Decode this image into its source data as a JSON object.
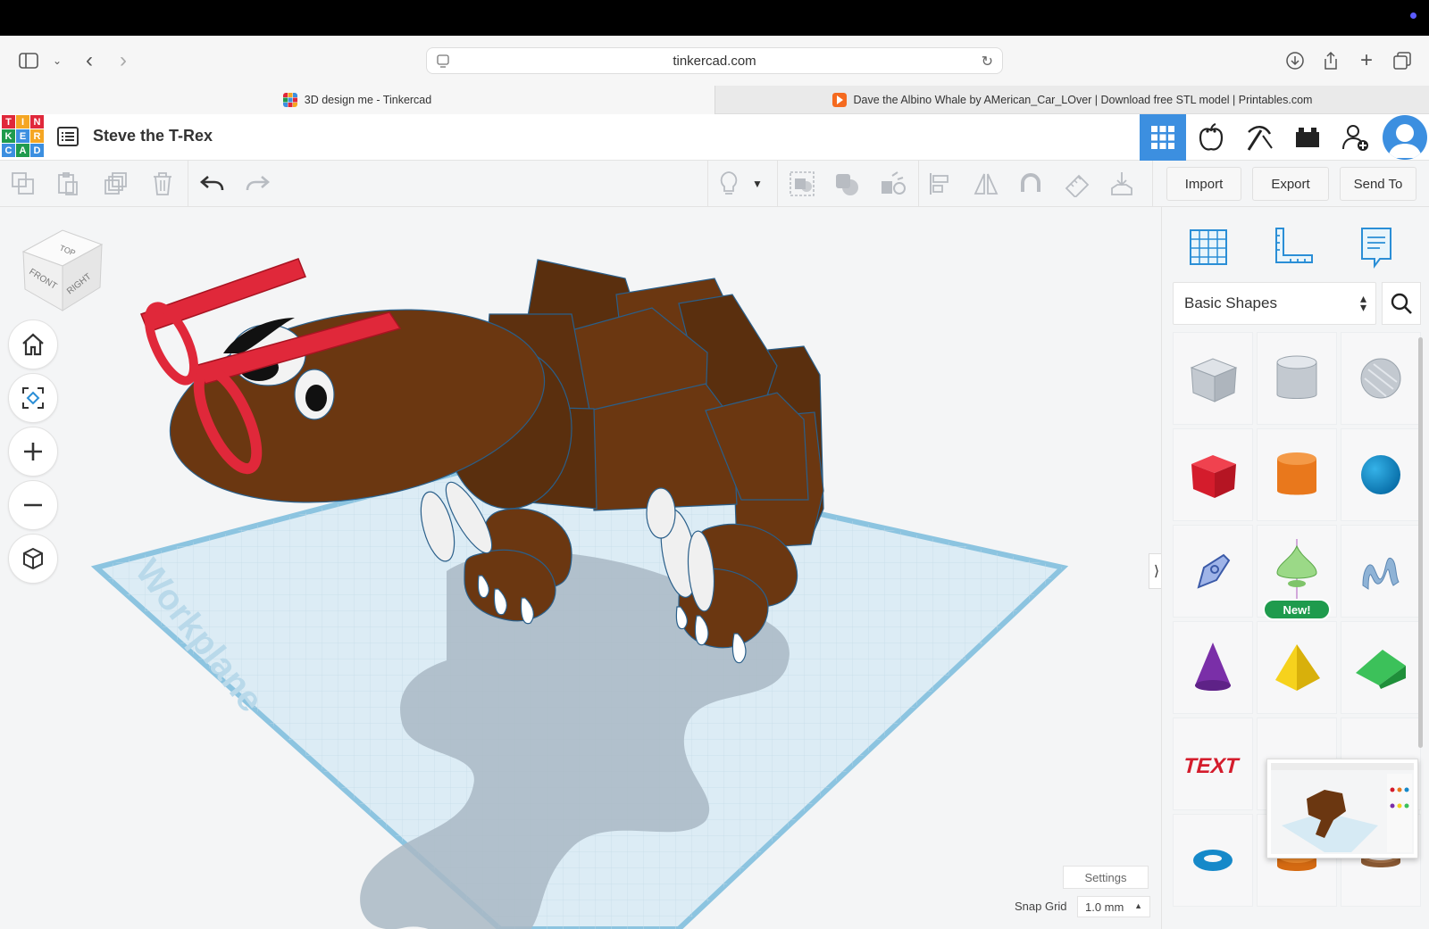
{
  "browser": {
    "url": "tinkercad.com",
    "tabs": [
      {
        "label": "3D design me - Tinkercad"
      },
      {
        "label": "Dave the Albino Whale by AMerican_Car_LOver | Download free STL model | Printables.com"
      }
    ]
  },
  "app": {
    "logo_letters": [
      "T",
      "I",
      "N",
      "K",
      "E",
      "R",
      "C",
      "A",
      "D"
    ],
    "design_title": "Steve the T-Rex"
  },
  "toolbar": {
    "import_label": "Import",
    "export_label": "Export",
    "send_to_label": "Send To"
  },
  "viewport": {
    "view_cube": {
      "top": "TOP",
      "front": "FRONT",
      "right": "RIGHT"
    },
    "workplane_label": "Workplane",
    "settings_label": "Settings",
    "snap_grid_label": "Snap Grid",
    "snap_grid_value": "1.0 mm"
  },
  "panel": {
    "category": "Basic Shapes",
    "new_badge": "New!",
    "shapes": [
      "box",
      "cylinder",
      "sphere",
      "box-solid",
      "cylinder-solid",
      "sphere-solid",
      "scribble",
      "torus-paraboloid",
      "text-solid",
      "cone",
      "pyramid",
      "wedge",
      "text",
      "torus",
      "tube",
      "ring"
    ],
    "text_shape_label": "TEXT"
  },
  "colors": {
    "accent": "#3c8fe0",
    "workplane": "#dcecf5",
    "dino_brown": "#6b3711",
    "red": "#e0283a",
    "green_badge": "#1f9b4d"
  }
}
